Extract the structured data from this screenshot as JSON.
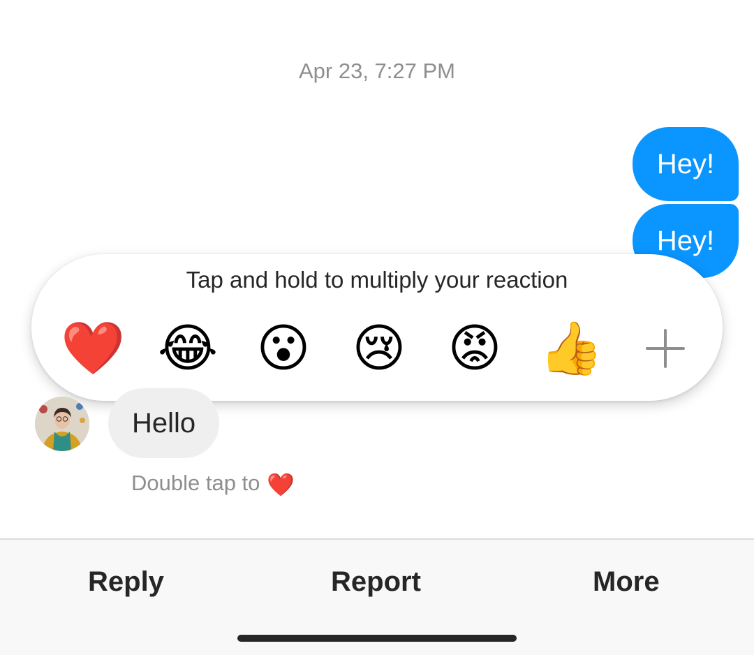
{
  "thread": {
    "timestamp": "Apr 23, 7:27 PM",
    "outgoing_messages": [
      "Hey!",
      "Hey!"
    ],
    "incoming_message": "Hello",
    "double_tap_hint": "Double tap to",
    "double_tap_icon": "heart-icon"
  },
  "reaction_picker": {
    "hint": "Tap and hold to multiply your reaction",
    "emojis": [
      {
        "name": "heart-emoji",
        "glyph": "❤️"
      },
      {
        "name": "tears-of-joy-emoji",
        "glyph": "😂"
      },
      {
        "name": "surprised-emoji",
        "glyph": "😮"
      },
      {
        "name": "crying-emoji",
        "glyph": "😢"
      },
      {
        "name": "angry-emoji",
        "glyph": "😡"
      },
      {
        "name": "thumbs-up-emoji",
        "glyph": "👍"
      }
    ],
    "more_icon": "plus-icon"
  },
  "actions": {
    "reply": "Reply",
    "report": "Report",
    "more": "More"
  },
  "colors": {
    "outgoing_bubble": "#0a95ff",
    "incoming_bubble": "#efefef",
    "muted_text": "#8e8e8e"
  }
}
